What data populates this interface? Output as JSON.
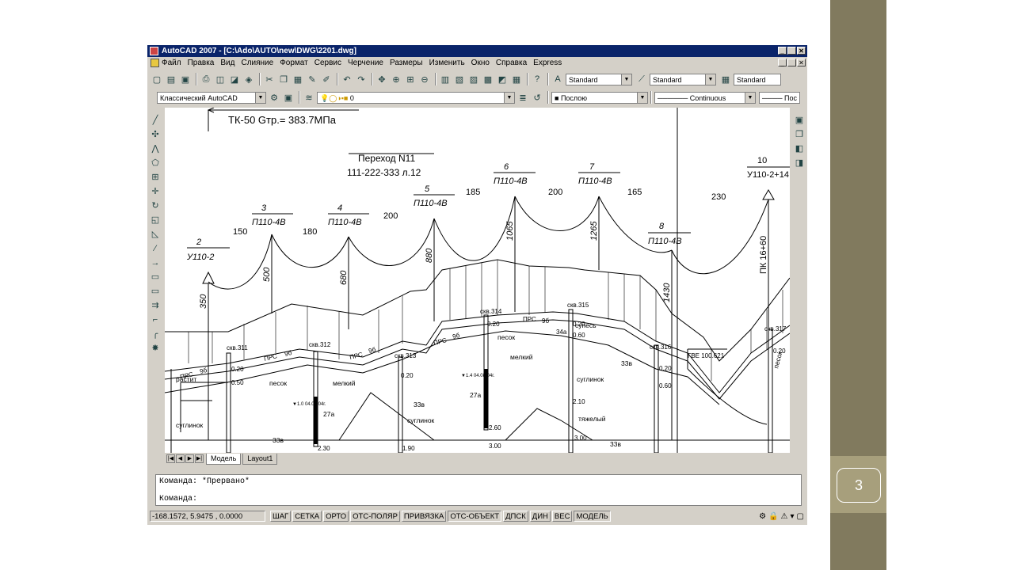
{
  "slide": {
    "number": "3"
  },
  "window": {
    "title": "AutoCAD 2007 - [C:\\Ado\\AUTO\\new\\DWG\\2201.dwg]",
    "controls": [
      "_",
      " ",
      "✕"
    ]
  },
  "menu": [
    "Файл",
    "Правка",
    "Вид",
    "Слияние",
    "Формат",
    "Сервис",
    "Черчение",
    "Размеры",
    "Изменить",
    "Окно",
    "Справка",
    "Express"
  ],
  "toolbar": {
    "text_style": "Standard",
    "dim_style": "Standard",
    "table_style": "Standard",
    "workspace": "Классический AutoCAD",
    "layer": "0",
    "color": "Послою",
    "linetype": "Continuous",
    "lineweight": "Пос"
  },
  "drawing": {
    "header": "ТК-50   Gтр.= 383.7МПа",
    "crossing_title": "Переход N11",
    "crossing_sub": "111-222-333 л.12",
    "towers": [
      {
        "num": "2",
        "type": "У110-2"
      },
      {
        "num": "3",
        "type": "П110-4В"
      },
      {
        "num": "4",
        "type": "П110-4В"
      },
      {
        "num": "5",
        "type": "П110-4В"
      },
      {
        "num": "6",
        "type": "П110-4В"
      },
      {
        "num": "7",
        "type": "П110-4В"
      },
      {
        "num": "8",
        "type": "П110-4В"
      },
      {
        "num": "10",
        "type": "У110-2+14"
      }
    ],
    "spans": [
      "150",
      "180",
      "200",
      "185",
      "200",
      "165",
      "230"
    ],
    "heights": [
      "350",
      "500",
      "680",
      "880",
      "1065",
      "1265",
      "1430"
    ],
    "picket": "ПК 16+60",
    "wells": [
      "скв.311",
      "скв.312",
      "скв.313",
      "скв.314",
      "скв.315",
      "скв.316",
      "скв.317"
    ],
    "soils": [
      "песок",
      "мелкий",
      "суглинок",
      "суглинок",
      "песок",
      "мелкий",
      "супесь",
      "суглинок",
      "тяжелый",
      "песок"
    ],
    "codes": [
      "33в",
      "27а",
      "33в",
      "27а",
      "33в",
      "33в",
      "33в"
    ],
    "depths": [
      "0.20",
      "0.50",
      "0.20",
      "0.20",
      "0.20",
      "0.60",
      "2.10",
      "2.30",
      "1.90",
      "3.00",
      "2.60",
      "3.00",
      "0.20",
      "0.60",
      "0.20"
    ],
    "marks": [
      "ПРС",
      "9б",
      "ПРС",
      "9б",
      "ПРС",
      "9б",
      "ПРС",
      "9б",
      "ПРС",
      "9б",
      "34а",
      "ГВЕ 100.621"
    ],
    "water": [
      "▼1.0\n04.08.04г.",
      "▼1.4\n04.08.04г."
    ],
    "misc": [
      "растит",
      "сугл"
    ]
  },
  "tabs": [
    "Модель",
    "Layout1"
  ],
  "command": {
    "line1": "Команда: *Прервано*",
    "line2": "Команда:"
  },
  "status": {
    "coords": "-168.1572, 5.9475 , 0.0000",
    "buttons": [
      "ШАГ",
      "СЕТКА",
      "ОРТО",
      "ОТС-ПОЛЯР",
      "ПРИВЯЗКА",
      "ОТС-ОБЪЕКТ",
      "ДПСК",
      "ДИН",
      "ВЕС",
      "МОДЕЛЬ"
    ],
    "active": [
      "ОТС-ОБЪЕКТ",
      "МОДЕЛЬ"
    ]
  }
}
